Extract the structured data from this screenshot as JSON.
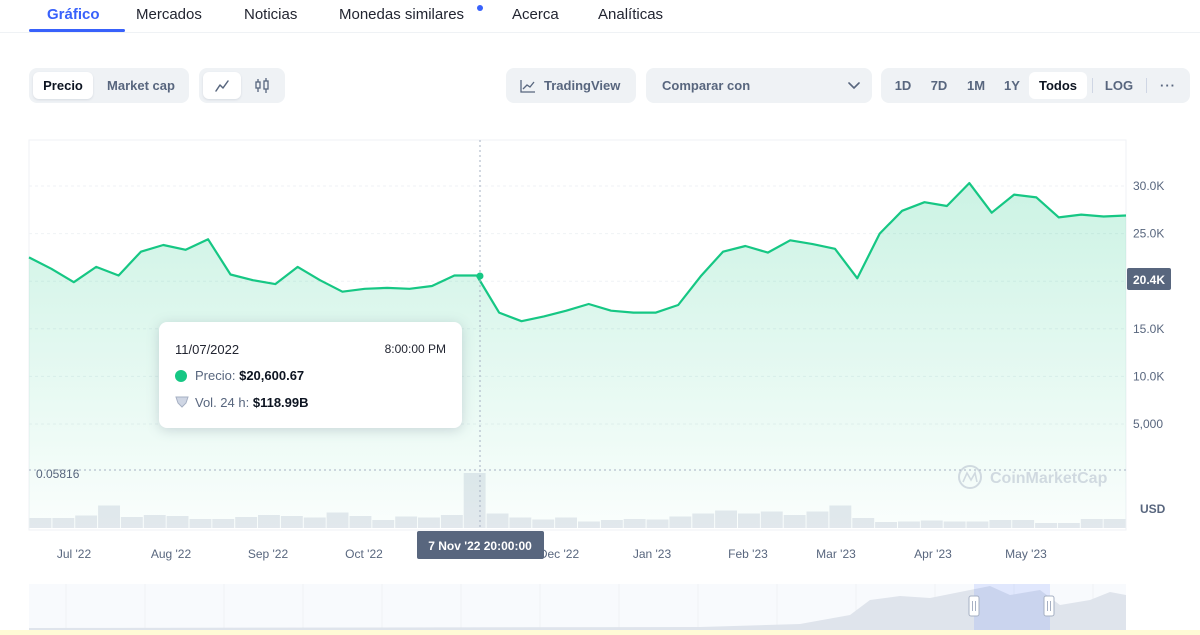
{
  "tabs": [
    {
      "label": "Gráfico"
    },
    {
      "label": "Mercados"
    },
    {
      "label": "Noticias"
    },
    {
      "label": "Monedas similares"
    },
    {
      "label": "Acerca"
    },
    {
      "label": "Analíticas"
    }
  ],
  "toolbar": {
    "price_label": "Precio",
    "market_cap_label": "Market cap",
    "line_icon": "line-chart-icon",
    "candle_icon": "candlestick-icon",
    "tradingview_label": "TradingView",
    "compare_label": "Comparar con",
    "ranges": [
      "1D",
      "7D",
      "1M",
      "1Y",
      "Todos"
    ],
    "log_label": "LOG",
    "more_label": "···"
  },
  "chart_data": {
    "type": "area",
    "x": [
      "Jun '22 end",
      "Jul '22",
      "Jul '22",
      "Jul '22",
      "Jul '22",
      "Aug '22",
      "Aug '22",
      "Aug '22",
      "Aug '22",
      "Aug '22",
      "Sep '22",
      "Sep '22",
      "Sep '22",
      "Sep '22",
      "Oct '22",
      "Oct '22",
      "Oct '22",
      "Oct '22",
      "Oct '22",
      "Nov '22",
      "Nov '22",
      "Nov '22",
      "Dec '22",
      "Dec '22",
      "Dec '22",
      "Jan '23",
      "Jan '23",
      "Jan '23",
      "Jan '23",
      "Feb '23",
      "Feb '23",
      "Feb '23",
      "Mar '23",
      "Mar '23",
      "Mar '23",
      "Mar '23",
      "Apr '23",
      "Apr '23",
      "Apr '23",
      "Apr '23",
      "May '23",
      "May '23",
      "May '23",
      "May '23",
      "Jun '23"
    ],
    "values": [
      22500,
      21300,
      19900,
      21500,
      20600,
      23100,
      23800,
      23300,
      24400,
      20700,
      20100,
      19700,
      21500,
      20100,
      18900,
      19200,
      19300,
      19200,
      19500,
      20600,
      20600,
      16700,
      15800,
      16300,
      16900,
      17600,
      16900,
      16700,
      16700,
      17500,
      20500,
      23100,
      23700,
      23000,
      24300,
      23900,
      23400,
      20300,
      25000,
      27400,
      28300,
      27900,
      30300,
      27200,
      29100,
      28800,
      26700,
      27000,
      26800,
      26900
    ],
    "yticks": [
      "5,000",
      "10.0K",
      "15.0K",
      "20.0K",
      "25.0K",
      "30.0K"
    ],
    "ylim": [
      0,
      35000
    ],
    "xticks": [
      "Jul '22",
      "Aug '22",
      "Sep '22",
      "Oct '22",
      "Nov '22",
      "Dec '22",
      "Jan '23",
      "Feb '23",
      "Mar '23",
      "Apr '23",
      "May '23"
    ],
    "current_price_label": "20.4K",
    "baseline_label": "0.05816",
    "volume_unit_label": "USD",
    "hover_x_label": "7 Nov '22 20:00:00",
    "volume": [
      2,
      2,
      2.5,
      4.5,
      2.2,
      2.6,
      2.4,
      1.8,
      1.8,
      2.2,
      2.6,
      2.4,
      2.1,
      3.1,
      2.4,
      1.6,
      2.3,
      2.1,
      2.6,
      11,
      2.9,
      2.1,
      1.7,
      2.1,
      1.3,
      1.6,
      1.8,
      1.7,
      2.3,
      2.9,
      3.5,
      2.9,
      3.3,
      2.6,
      3.3,
      4.5,
      2.0,
      1.2,
      1.3,
      1.5,
      1.3,
      1.3,
      1.6,
      1.6,
      1.0,
      1.0,
      1.8,
      1.8
    ]
  },
  "tooltip": {
    "date": "11/07/2022",
    "time": "8:00:00 PM",
    "price_label": "Precio:",
    "price_value": "$20,600.67",
    "volume_label": "Vol. 24 h:",
    "volume_value": "$118.99B"
  },
  "watermark": "CoinMarketCap",
  "colors": {
    "accent": "#3861fb",
    "line": "#16c784",
    "fill": "#16c784",
    "label_bg": "#58667e"
  }
}
